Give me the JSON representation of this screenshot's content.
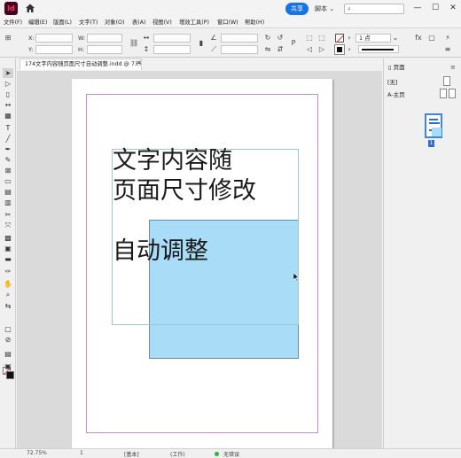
{
  "app": {
    "icon_label": "Id",
    "share_label": "共享",
    "workspace_label": "脚本 ⌄",
    "search_placeholder": ""
  },
  "window_controls": {
    "minimize": "—",
    "maximize": "☐",
    "close": "✕"
  },
  "menu": [
    "文件(F)",
    "编辑(E)",
    "版面(L)",
    "文字(T)",
    "对象(O)",
    "表(A)",
    "视图(V)",
    "增效工具(P)",
    "窗口(W)",
    "帮助(H)"
  ],
  "control_bar": {
    "x_label": "X:",
    "y_label": "Y:",
    "w_label": "W:",
    "h_label": "H:",
    "stroke_weight": "1 点"
  },
  "document_tab": {
    "title": "174文字内容随页面尺寸自动调整.indd @ 73%",
    "close": "✕"
  },
  "frame_text": {
    "line1": "文字内容随",
    "line2": "页面尺寸修改",
    "line3": "",
    "line4": "自动调整"
  },
  "pages_panel": {
    "tab": "页面",
    "none_label": "[无]",
    "master_label": "A-主页",
    "page_number": "1",
    "menu_icon": "≡"
  },
  "status_bar": {
    "zoom": "72.75%",
    "page": "1",
    "base_label": "[基本]",
    "work_label": "(工作)",
    "preflight": "无错误"
  },
  "icons": {
    "tools": [
      "selection-icon",
      "direct-selection-icon",
      "page-tool-icon",
      "gap-tool-icon",
      "content-collector-icon",
      "type-icon",
      "line-icon",
      "pen-icon",
      "pencil-icon",
      "rect-frame-icon",
      "rectangle-icon",
      "table-icon",
      "grid-icon",
      "scissors-icon",
      "free-transform-icon",
      "gradient-icon",
      "gradient-feather-icon",
      "note-icon",
      "eyedropper-icon",
      "hand-icon",
      "zoom-icon"
    ]
  }
}
